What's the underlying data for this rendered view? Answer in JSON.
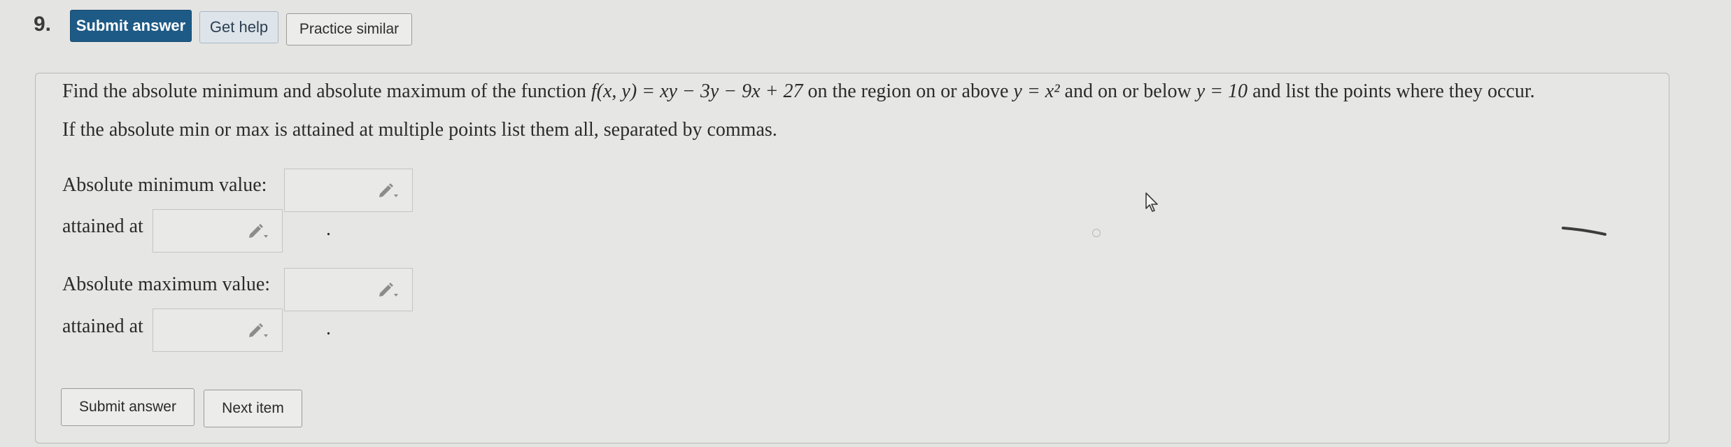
{
  "question": {
    "number": "9."
  },
  "toolbar": {
    "submit_label": "Submit answer",
    "help_label": "Get help",
    "similar_label": "Practice similar"
  },
  "prompt": {
    "line1_a": "Find the absolute minimum and absolute maximum of the function ",
    "function": "f(x, y) = xy − 3y − 9x + 27",
    "line1_b": " on the region on or above ",
    "lower_curve": "y = x²",
    "line1_c": " and on or below ",
    "upper_line": "y = 10",
    "line1_d": " and list the points where they occur.",
    "line2": "If the absolute min or max is attained at multiple points list them all, separated by commas."
  },
  "answers": {
    "min_value_label": "Absolute minimum value:",
    "min_attained_label": "attained at",
    "max_value_label": "Absolute maximum value:",
    "max_attained_label": "attained at",
    "min_value": "",
    "min_points": "",
    "max_value": "",
    "max_points": "",
    "period": "."
  },
  "footer": {
    "submit_label": "Submit answer",
    "next_label": "Next item"
  },
  "icons": {
    "field_edit": "pencil-icon",
    "cursor": "mouse-pointer-icon"
  }
}
